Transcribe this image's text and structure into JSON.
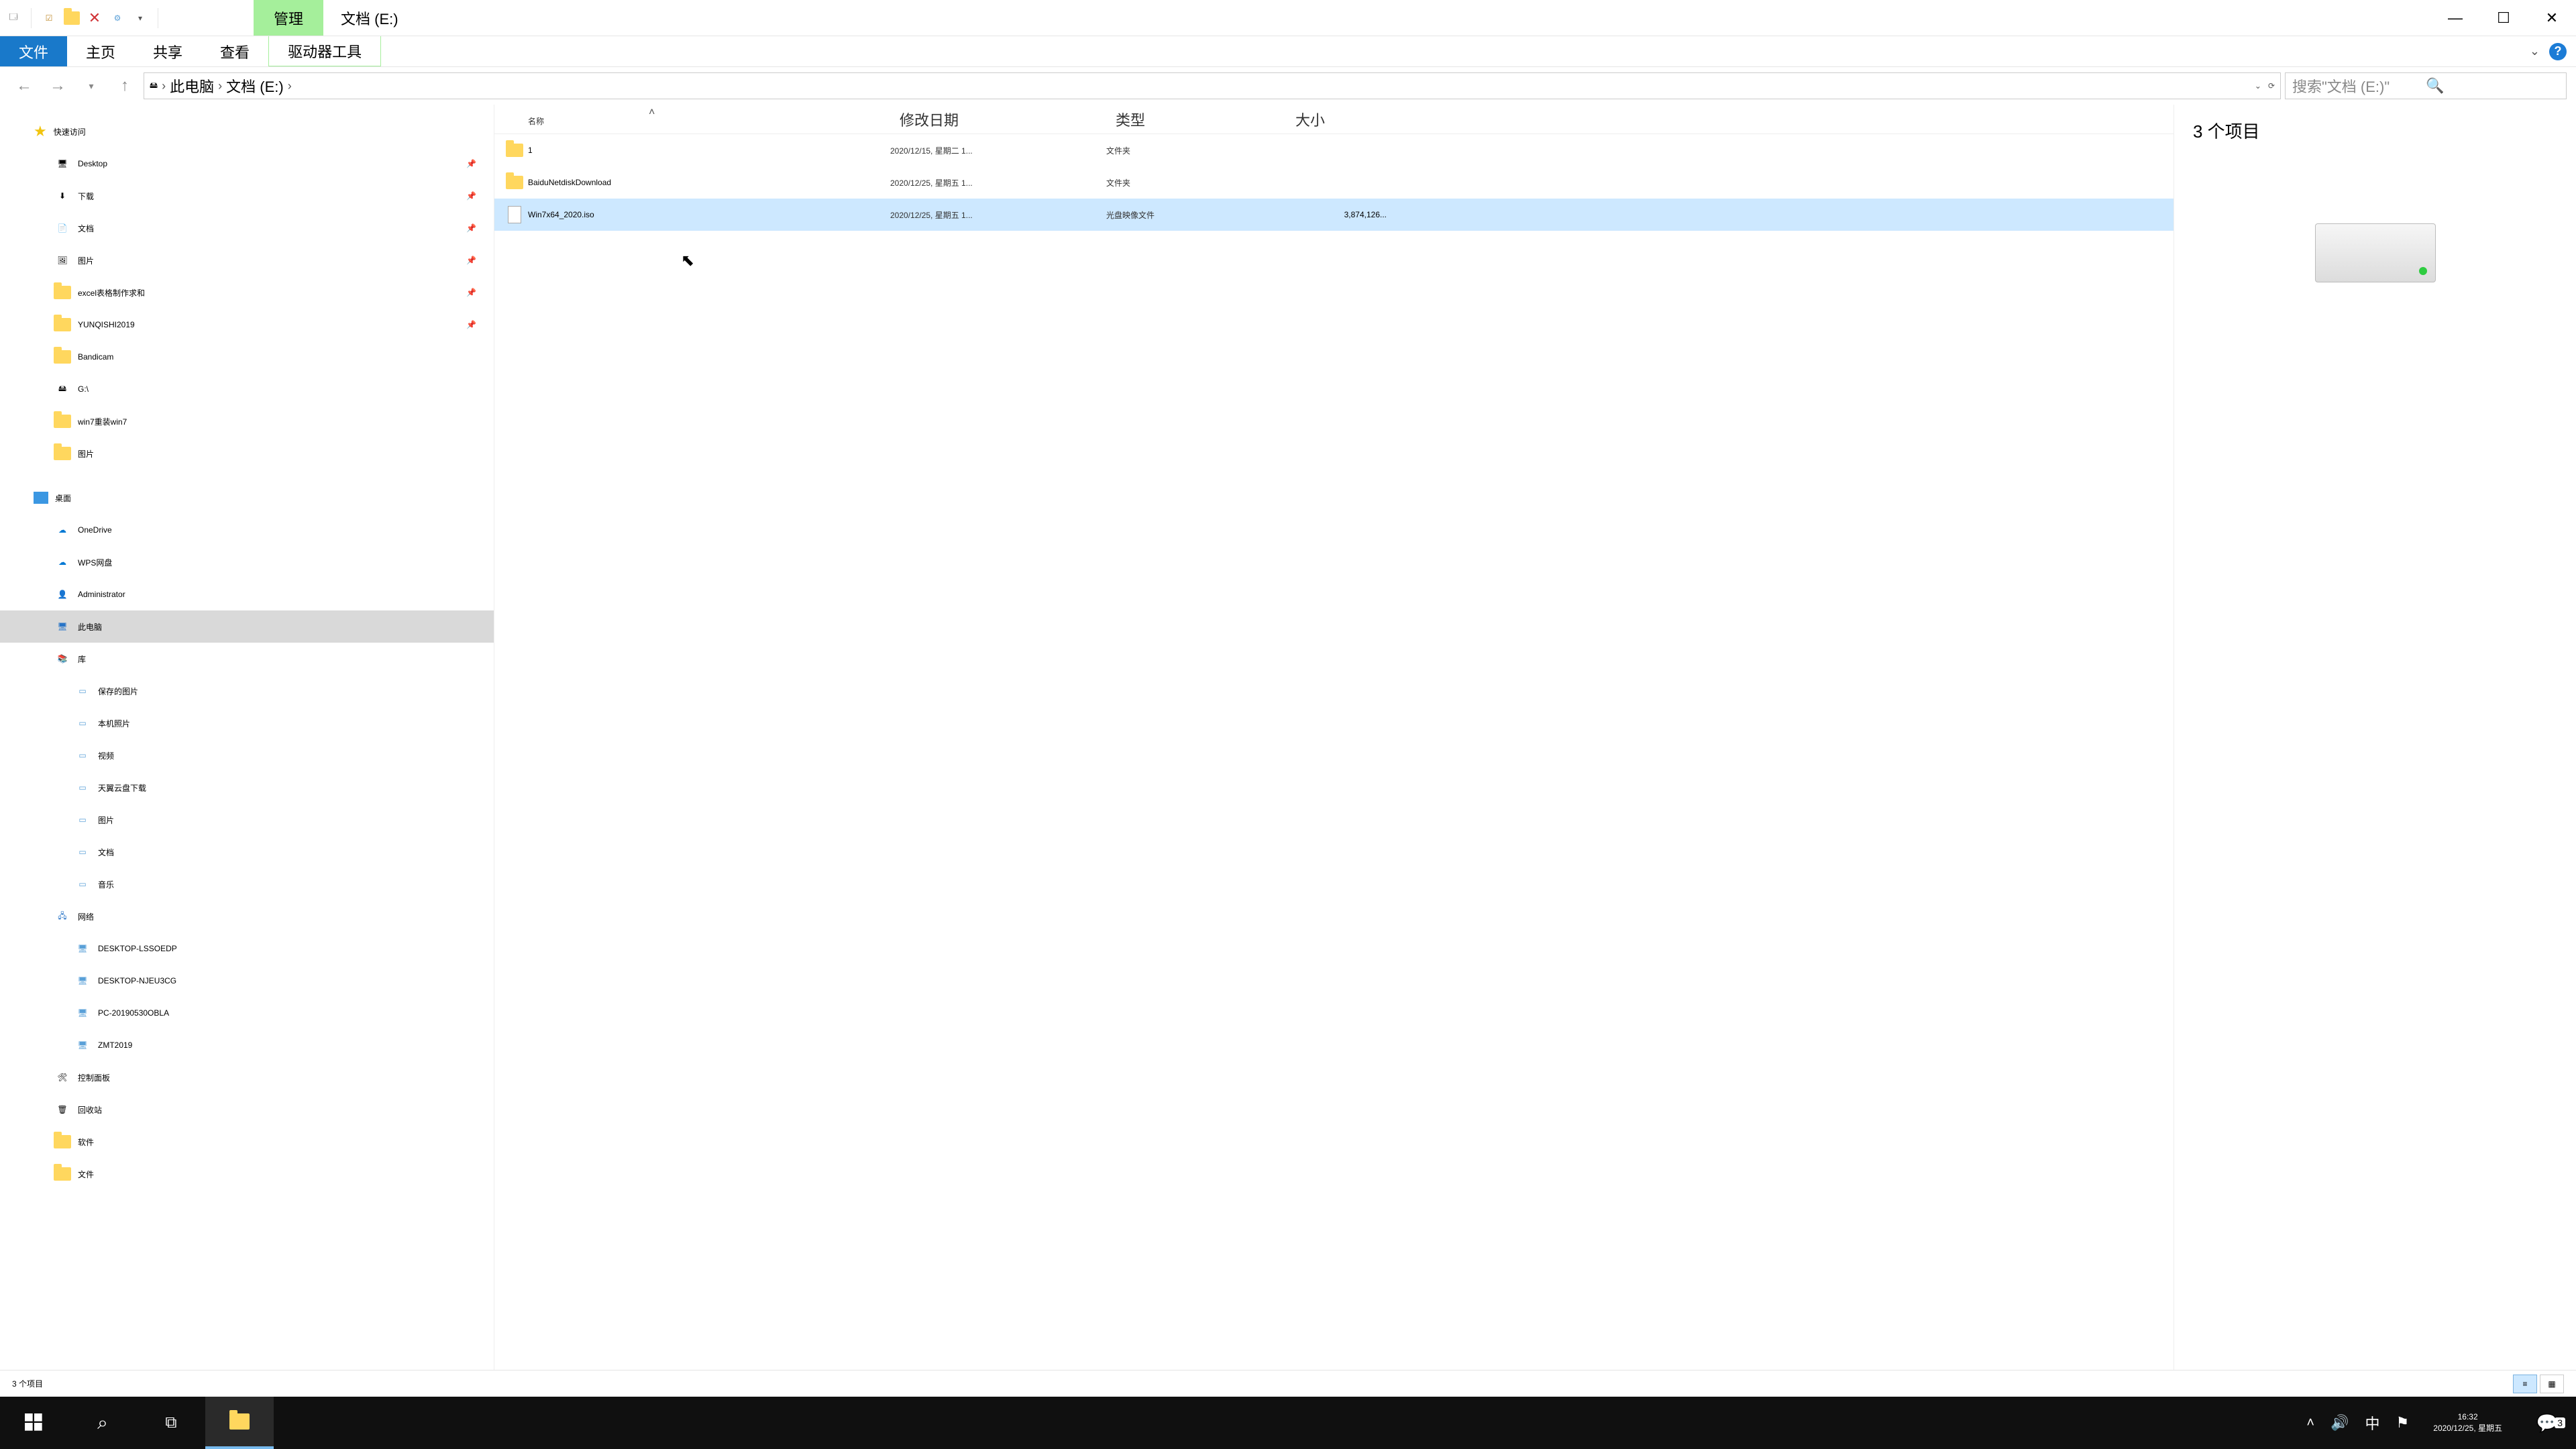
{
  "titlebar": {
    "context_tab": "管理",
    "title": "文档 (E:)"
  },
  "ribbon": {
    "file": "文件",
    "home": "主页",
    "share": "共享",
    "view": "查看",
    "drive_tools": "驱动器工具"
  },
  "address": {
    "crumbs": [
      "此电脑",
      "文档 (E:)"
    ],
    "search_placeholder": "搜索\"文档 (E:)\""
  },
  "nav": {
    "quick_access": "快速访问",
    "quick_items": [
      {
        "label": "Desktop",
        "icon": "desktop",
        "pinned": true
      },
      {
        "label": "下载",
        "icon": "download",
        "pinned": true
      },
      {
        "label": "文档",
        "icon": "doc",
        "pinned": true
      },
      {
        "label": "图片",
        "icon": "pic",
        "pinned": true
      },
      {
        "label": "excel表格制作求和",
        "icon": "folder",
        "pinned": true
      },
      {
        "label": "YUNQISHI2019",
        "icon": "folder",
        "pinned": true
      },
      {
        "label": "Bandicam",
        "icon": "folder",
        "pinned": false
      },
      {
        "label": "G:\\",
        "icon": "drive",
        "pinned": false
      },
      {
        "label": "win7重装win7",
        "icon": "folder",
        "pinned": false
      },
      {
        "label": "图片",
        "icon": "folder",
        "pinned": false
      }
    ],
    "desktop": "桌面",
    "desktop_items": [
      "OneDrive",
      "WPS网盘",
      "Administrator",
      "此电脑",
      "库"
    ],
    "library_items": [
      "保存的图片",
      "本机照片",
      "视频",
      "天翼云盘下载",
      "图片",
      "文档",
      "音乐"
    ],
    "network": "网络",
    "network_items": [
      "DESKTOP-LSSOEDP",
      "DESKTOP-NJEU3CG",
      "PC-20190530OBLA",
      "ZMT2019"
    ],
    "control_panel": "控制面板",
    "recycle": "回收站",
    "software": "软件",
    "docs": "文件"
  },
  "columns": {
    "name": "名称",
    "date": "修改日期",
    "type": "类型",
    "size": "大小"
  },
  "files": [
    {
      "name": "1",
      "date": "2020/12/15, 星期二 1...",
      "type": "文件夹",
      "size": "",
      "icon": "folder"
    },
    {
      "name": "BaiduNetdiskDownload",
      "date": "2020/12/25, 星期五 1...",
      "type": "文件夹",
      "size": "",
      "icon": "folder"
    },
    {
      "name": "Win7x64_2020.iso",
      "date": "2020/12/25, 星期五 1...",
      "type": "光盘映像文件",
      "size": "3,874,126...",
      "icon": "file",
      "selected": true
    }
  ],
  "preview": {
    "summary": "3 个项目"
  },
  "statusbar": {
    "text": "3 个项目"
  },
  "taskbar": {
    "time": "16:32",
    "date": "2020/12/25, 星期五",
    "ime": "中",
    "notifications": "3"
  }
}
